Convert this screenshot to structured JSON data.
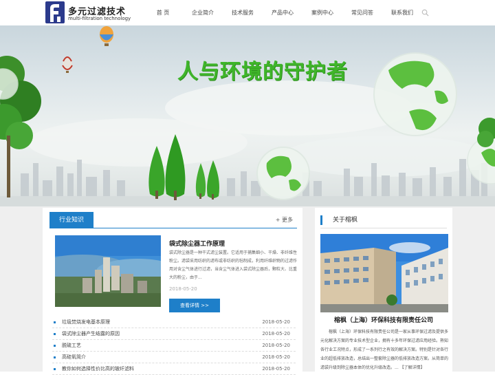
{
  "logo": {
    "cn": "多元过滤技术",
    "en": "multi-filtration technology"
  },
  "nav": [
    {
      "label": "首 页"
    },
    {
      "label": "企业简介"
    },
    {
      "label": "技术服务"
    },
    {
      "label": "产品中心"
    },
    {
      "label": "案例中心"
    },
    {
      "label": "常见问答"
    },
    {
      "label": "联系我们"
    }
  ],
  "banner": {
    "slogan": "人与环境的守护者"
  },
  "industry": {
    "tab": "行业知识",
    "more": "+ 更多",
    "featured": {
      "title": "袋式除尘器工作原理",
      "desc": "袋式除尘器是一种干式滤尘装置。它适用于捕集细小、干燥、非纤维性粉尘。滤袋采用纺织的滤布或非纺织的毡制成，利用纤维织物的过滤作用对含尘气体进行过滤，当含尘气体进入袋式除尘器后，颗粒大、比重大的粉尘，由于...",
      "date": "2018-05-20",
      "button": "查看详情 >>"
    },
    "news": [
      {
        "title": "垃圾焚烧发电基本原理",
        "date": "2018-05-20"
      },
      {
        "title": "袋式除尘器产生结露的原因",
        "date": "2018-05-20"
      },
      {
        "title": "脱硫工艺",
        "date": "2018-05-20"
      },
      {
        "title": "高硅氧简介",
        "date": "2018-05-20"
      },
      {
        "title": "教你如何选择性价比高的玻纤滤料",
        "date": "2018-05-20"
      }
    ]
  },
  "about": {
    "title": "关于榕枫",
    "company": "榕枫（上海）环保科技有限责任公司",
    "desc": "榕枫（上海）环保科技有限责任公司是一家从事环保过滤及提供多元化解决方案的专业技术型企业，拥有十多年环保过滤应用经验。熟知各行业工况特点，形成了一系列行之有效的解决方案。特别是针对各行业的超低排放改造，总结出一整套除尘器的低排放改造方案。从简单的滤袋升级到除尘器本体的优化升级改造。... 【了解详情】"
  },
  "colors": {
    "accent": "#1e7fc9",
    "slogan": "#3fb52a",
    "logo": "#2b3a8c"
  }
}
